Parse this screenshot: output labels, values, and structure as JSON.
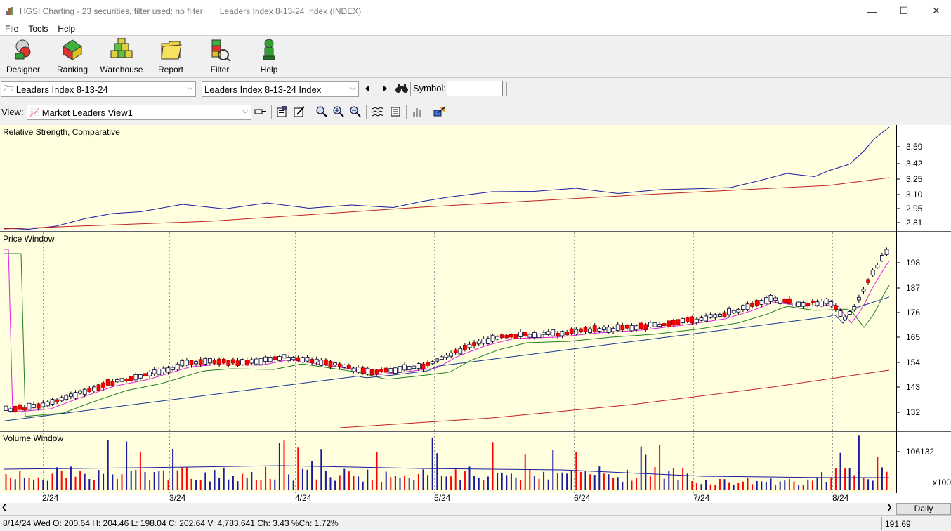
{
  "window": {
    "title": "HGSI Charting - 23 securities, filter used: no filter",
    "subtitle": "Leaders Index 8-13-24 Index (INDEX)"
  },
  "menu": [
    "File",
    "Tools",
    "Help"
  ],
  "toolbar": {
    "buttons": [
      {
        "label": "Designer",
        "icon": "designer-icon"
      },
      {
        "label": "Ranking",
        "icon": "ranking-icon"
      },
      {
        "label": "Warehouse",
        "icon": "warehouse-icon"
      },
      {
        "label": "Report",
        "icon": "report-icon"
      },
      {
        "label": "Filter",
        "icon": "filter-icon"
      },
      {
        "label": "Help",
        "icon": "help-icon"
      }
    ]
  },
  "selectors": {
    "folder": "Leaders Index 8-13-24",
    "security": "Leaders Index 8-13-24 Index",
    "symbol_label": "Symbol:",
    "symbol_value": "",
    "view_label": "View:",
    "view": "Market Leaders View1"
  },
  "panes": {
    "rs": {
      "label": "Relative Strength, Comparative",
      "ticks": [
        "3.59",
        "3.42",
        "3.25",
        "3.10",
        "2.95",
        "2.81"
      ]
    },
    "price": {
      "label": "Price Window",
      "ticks": [
        "198",
        "187",
        "176",
        "165",
        "154",
        "143",
        "132"
      ]
    },
    "volume": {
      "label": "Volume Window",
      "ticks": [
        "106132"
      ],
      "unit": "x100"
    }
  },
  "x_axis": [
    "2/24",
    "3/24",
    "4/24",
    "5/24",
    "6/24",
    "7/24",
    "8/24"
  ],
  "period": "Daily",
  "status": {
    "ohlc": "8/14/24 Wed O: 200.64 H: 204.46 L: 198.04 C: 202.64 V: 4,783,641 Ch: 3.43 %Ch: 1.72%",
    "value": "191.69"
  },
  "colors": {
    "pane_bg": "#ffffe0",
    "rs_line": "#1a1aa0",
    "rs_avg": "#c02020",
    "up_candle": "#ffffff",
    "down_candle": "#ff0000",
    "ma_magenta": "#e020e0",
    "ma_green": "#208020",
    "ma_blue": "#1a3a90",
    "ma_red": "#c02020"
  },
  "chart_data": {
    "type": "line",
    "title": "",
    "x": [
      "2/24",
      "3/24",
      "4/24",
      "5/24",
      "6/24",
      "7/24",
      "8/24"
    ],
    "series": [
      {
        "name": "Relative Strength, Comparative",
        "values": [
          2.81,
          2.93,
          2.96,
          2.95,
          3.05,
          3.12,
          3.18,
          3.62
        ]
      },
      {
        "name": "Price",
        "values": [
          132,
          148,
          154,
          150,
          164,
          169,
          178,
          202.64
        ]
      }
    ]
  }
}
